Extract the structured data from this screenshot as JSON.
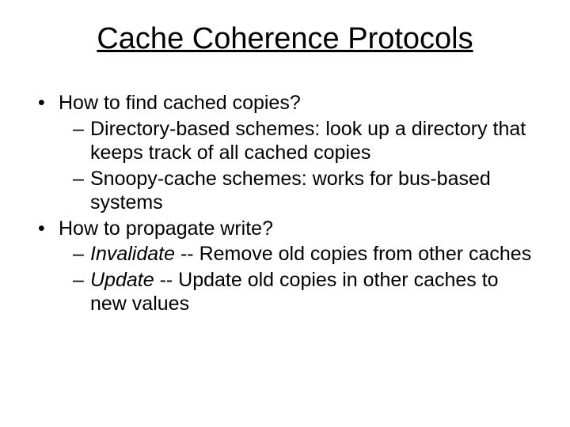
{
  "title": "Cache Coherence Protocols",
  "b1": "How to find cached copies?",
  "b1s1": "Directory-based schemes: look up a directory that keeps track of all cached copies",
  "b1s2": "Snoopy-cache schemes: works for bus-based systems",
  "b2": "How to propagate write?",
  "b2s1_em": "Invalidate",
  "b2s1_rest": " -- Remove old copies from other caches",
  "b2s2_em": "Update",
  "b2s2_rest": " -- Update old copies in other caches to new values"
}
